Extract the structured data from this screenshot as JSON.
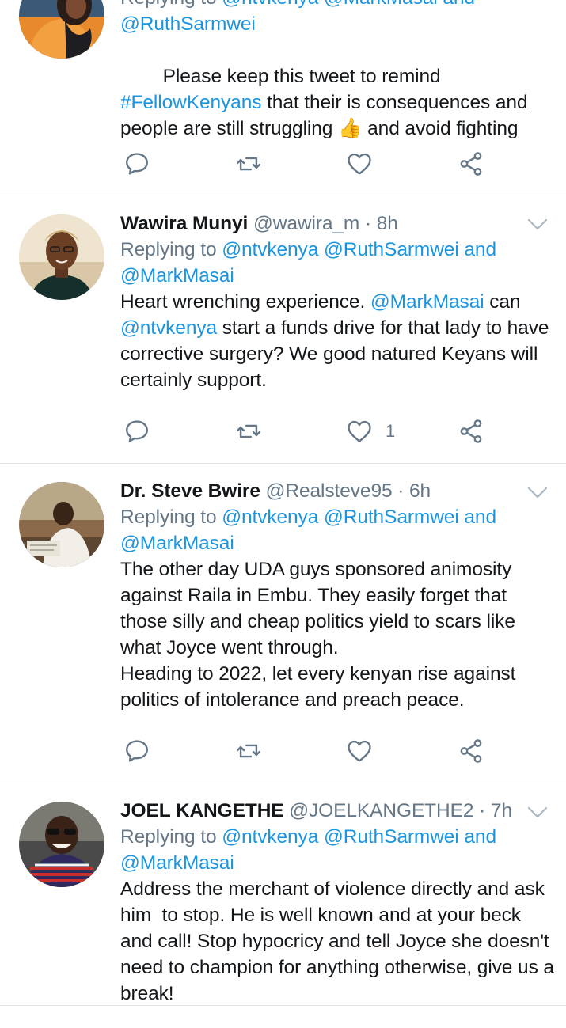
{
  "tweets": [
    {
      "reply_prefix": "Replying to ",
      "reply_mentions": [
        "@ntvkenya",
        "@MarkMasai",
        "and",
        "@RuthSarmwei"
      ],
      "text_parts": [
        {
          "t": "Please keep this tweet to remind ",
          "kind": "text"
        },
        {
          "t": "#FellowKenyans",
          "kind": "hashtag"
        },
        {
          "t": " that their is consequences and people are still struggling ",
          "kind": "text"
        },
        {
          "t": "👍",
          "kind": "emoji"
        },
        {
          "t": " and avoid fighting",
          "kind": "text"
        }
      ],
      "like_count": ""
    },
    {
      "name": "Wawira Munyi",
      "handle": "@wawira_m",
      "time": "8h",
      "reply_prefix": "Replying to",
      "reply_to": [
        "@ntvkenya",
        "@RuthSarmwei",
        "and",
        "@MarkMasai"
      ],
      "text_parts": [
        {
          "t": "Heart wrenching experience. ",
          "kind": "text"
        },
        {
          "t": "@MarkMasai",
          "kind": "mention"
        },
        {
          "t": " can ",
          "kind": "text"
        },
        {
          "t": "@ntvkenya",
          "kind": "mention"
        },
        {
          "t": " start a funds drive for that lady to have corrective surgery? We good natured Keyans will certainly support.",
          "kind": "text"
        }
      ],
      "like_count": "1"
    },
    {
      "name": "Dr. Steve Bwire",
      "handle": "@Realsteve95",
      "time": "6h",
      "reply_prefix": "Replying to",
      "reply_to": [
        "@ntvkenya",
        "@RuthSarmwei",
        "and",
        "@MarkMasai"
      ],
      "text_parts": [
        {
          "t": "The other day UDA guys sponsored animosity against Raila in Embu. They easily forget that those silly and cheap politics yield to scars like what Joyce went through.\nHeading to 2022, let every kenyan rise against politics of intolerance and preach peace.",
          "kind": "text"
        }
      ],
      "like_count": ""
    },
    {
      "name": "JOEL KANGETHE",
      "handle": "@JOELKANGETHE2",
      "time": "7h",
      "reply_prefix": "Replying to",
      "reply_to": [
        "@ntvkenya",
        "@RuthSarmwei",
        "and",
        "@MarkMasai"
      ],
      "text_parts": [
        {
          "t": "Address the merchant of violence directly and ask him  to stop. He is well known and at your beck and call! Stop hypocricy and tell Joyce she doesn't need to champion for anything otherwise, give us a break!",
          "kind": "text"
        }
      ],
      "like_count": ""
    }
  ],
  "separator_dot": "·",
  "icons": {
    "reply": "reply-icon",
    "retweet": "retweet-icon",
    "like": "heart-icon",
    "share": "share-icon",
    "menu": "chevron-down-icon"
  },
  "colors": {
    "link": "#1b95e0",
    "secondary": "#657786",
    "text": "#14171a",
    "divider": "#dfe3e6"
  }
}
